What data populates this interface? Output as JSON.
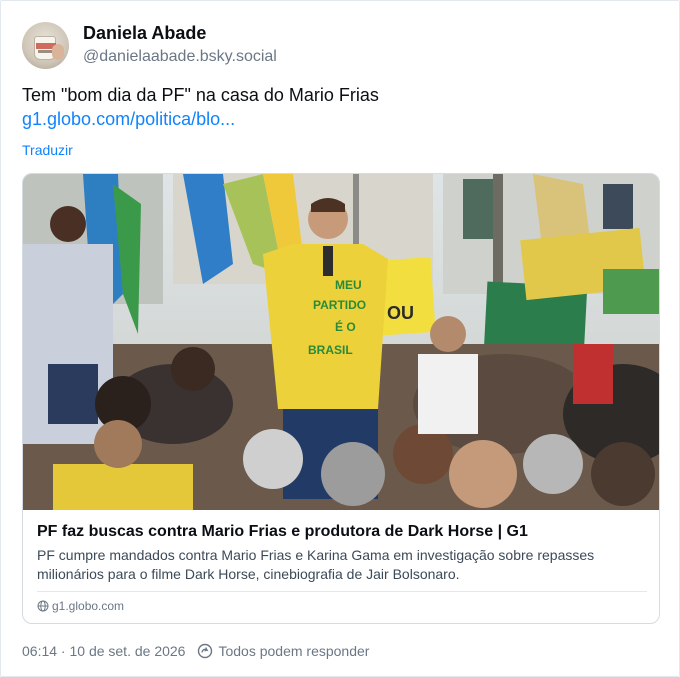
{
  "author": {
    "display_name": "Daniela Abade",
    "handle": "@danielaabade.bsky.social"
  },
  "post": {
    "text": "Tem \"bom dia da PF\" na casa do Mario Frias",
    "link_text": "g1.globo.com/politica/blo...",
    "translate_label": "Traduzir"
  },
  "embed": {
    "title": "PF faz buscas contra Mario Frias e produtora de Dark Horse | G1",
    "description": "PF cumpre mandados contra Mario Frias e Karina Gama em investigação sobre repasses milionários para o filme Dark Horse, cinebiografia de Jair Bolsonaro.",
    "domain": "g1.globo.com",
    "thumbnail_signs": [
      "MEU",
      "PARTIDO",
      "É O",
      "BRASIL",
      "OU"
    ]
  },
  "footer": {
    "timestamp": "06:14 · 10 de set. de 2026",
    "reply_setting": "Todos podem responder"
  },
  "colors": {
    "link": "#1083fe",
    "muted": "#6b7785",
    "text": "#0b0f14",
    "border": "#d4dbe2"
  }
}
